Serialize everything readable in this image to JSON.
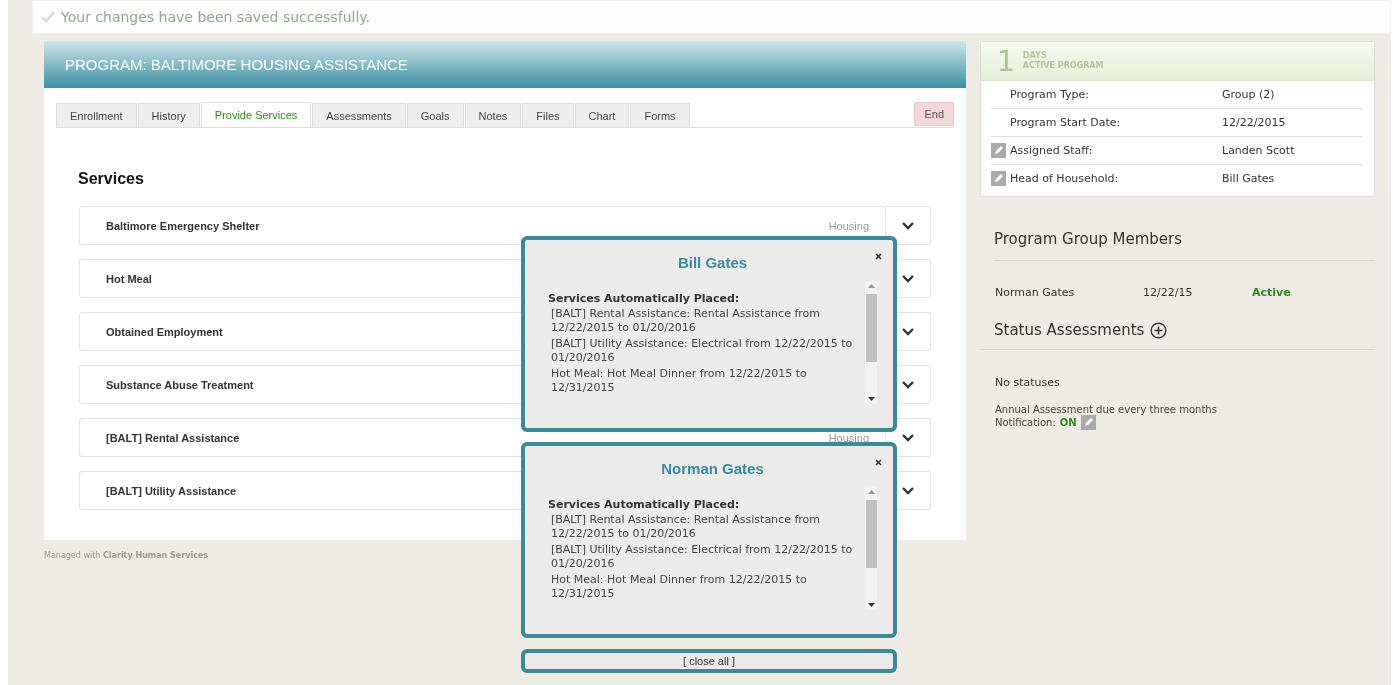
{
  "banner": {
    "message": "Your changes have been saved successfully."
  },
  "program": {
    "title": "PROGRAM: BALTIMORE HOUSING ASSISTANCE"
  },
  "tabs": [
    {
      "label": "Enrollment",
      "selected": false
    },
    {
      "label": "History",
      "selected": false
    },
    {
      "label": "Provide Services",
      "selected": true
    },
    {
      "label": "Assessments",
      "selected": false
    },
    {
      "label": "Goals",
      "selected": false
    },
    {
      "label": "Notes",
      "selected": false
    },
    {
      "label": "Files",
      "selected": false
    },
    {
      "label": "Chart",
      "selected": false
    },
    {
      "label": "Forms",
      "selected": false
    }
  ],
  "end_button": "End",
  "services": {
    "heading": "Services",
    "rows": [
      {
        "name": "Baltimore Emergency Shelter",
        "category": "Housing"
      },
      {
        "name": "Hot Meal"
      },
      {
        "name": "Obtained Employment"
      },
      {
        "name": "Substance Abuse Treatment"
      },
      {
        "name": "[BALT] Rental Assistance",
        "category": "Housing"
      },
      {
        "name": "[BALT] Utility Assistance"
      }
    ]
  },
  "footer": {
    "prefix": "Managed with",
    "brand": "Clarity Human Services"
  },
  "summary": {
    "days": "1",
    "days_label": "DAYS",
    "status_label": "ACTIVE PROGRAM",
    "fields": [
      {
        "label": "Program Type:",
        "value": "Group (2)",
        "editable": false
      },
      {
        "label": "Program Start Date:",
        "value": "12/22/2015",
        "editable": false
      },
      {
        "label": "Assigned Staff:",
        "value": "Landen Scott",
        "editable": true
      },
      {
        "label": "Head of Household:",
        "value": "Bill Gates",
        "editable": true
      }
    ]
  },
  "group_members": {
    "heading": "Program Group Members",
    "members": [
      {
        "name": "Norman Gates",
        "date": "12/22/15",
        "status": "Active",
        "color": "#2e8b1f"
      }
    ]
  },
  "status_assessments": {
    "heading": "Status Assessments",
    "empty": "No statuses",
    "schedule": "Annual Assessment due every three months",
    "notification_label": "Notification:",
    "notification_value": "ON"
  },
  "popups": [
    {
      "title": "Bill Gates",
      "heading": "Services Automatically Placed:",
      "items": [
        "[BALT] Rental Assistance: Rental Assistance from 12/22/2015 to 01/20/2016",
        "[BALT] Utility Assistance: Electrical from 12/22/2015 to 01/20/2016",
        "Hot Meal: Hot Meal Dinner from 12/22/2015 to 12/31/2015"
      ]
    },
    {
      "title": "Norman Gates",
      "heading": "Services Automatically Placed:",
      "items": [
        "[BALT] Rental Assistance: Rental Assistance from 12/22/2015 to 01/20/2016",
        "[BALT] Utility Assistance: Electrical from 12/22/2015 to 01/20/2016",
        "Hot Meal: Hot Meal Dinner from 12/22/2015 to 12/31/2015"
      ]
    }
  ],
  "close_all": "[ close all ]"
}
